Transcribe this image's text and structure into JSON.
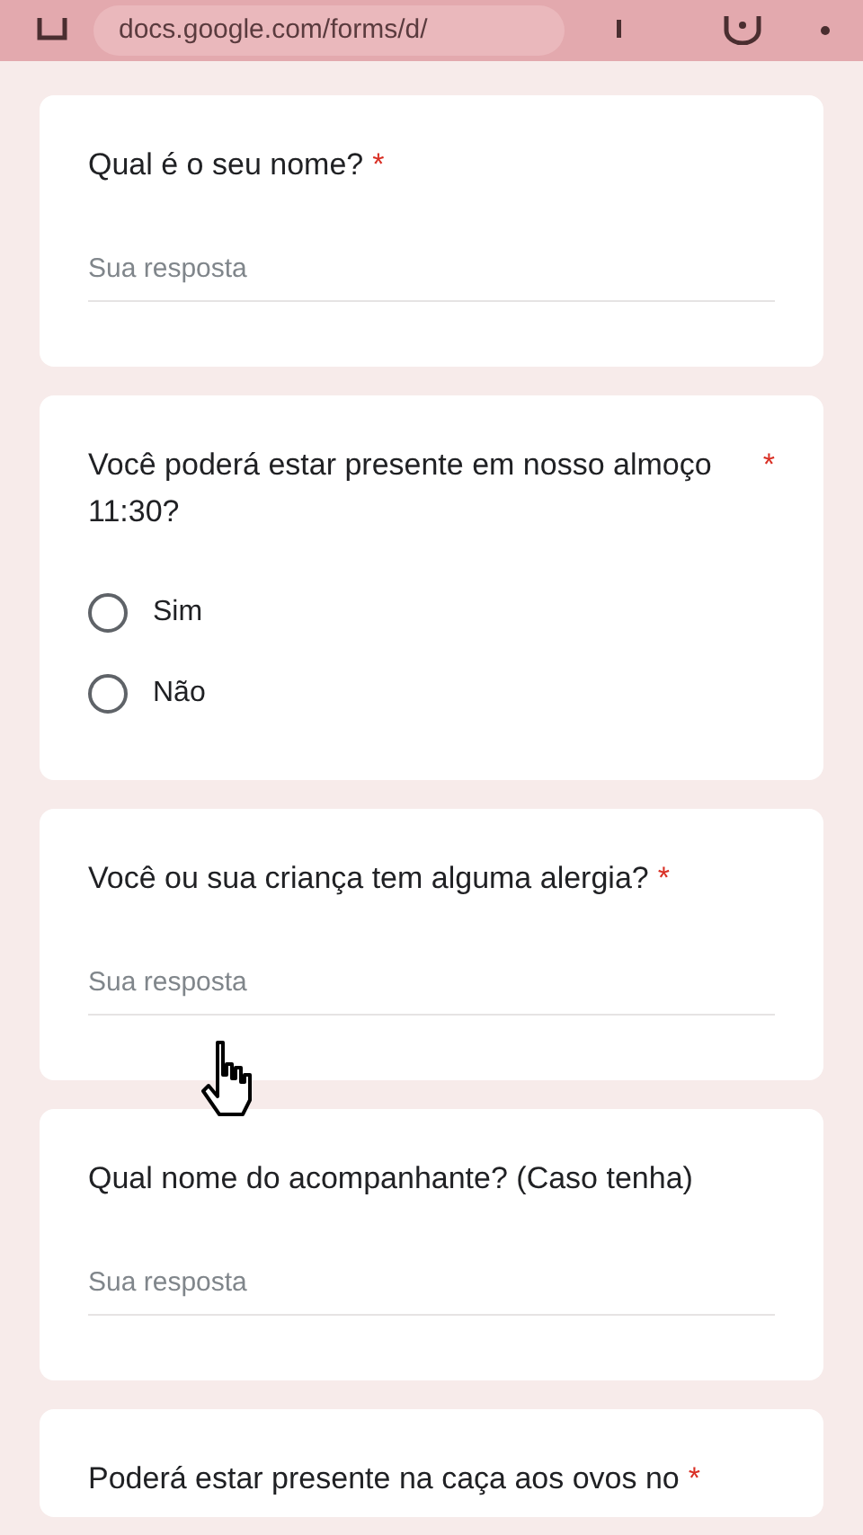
{
  "browser_bar": {
    "url": "docs.google.com/forms/d/"
  },
  "questions": [
    {
      "kind": "text",
      "title": "Qual é o seu nome?",
      "required_mark": "*",
      "placeholder": "Sua resposta"
    },
    {
      "kind": "radio",
      "title": "Você poderá estar presente em nosso almoço 11:30?",
      "required_mark": "*",
      "options": [
        {
          "label": "Sim",
          "selected": false
        },
        {
          "label": "Não",
          "selected": false
        }
      ]
    },
    {
      "kind": "text",
      "title": "Você ou sua criança tem alguma alergia?",
      "required_mark": "*",
      "placeholder": "Sua resposta"
    },
    {
      "kind": "text",
      "title": "Qual nome do acompanhante? (Caso tenha)",
      "placeholder": "Sua resposta"
    },
    {
      "kind": "partial",
      "title": "Poderá estar presente na caça aos ovos no",
      "required_mark": "*"
    }
  ]
}
